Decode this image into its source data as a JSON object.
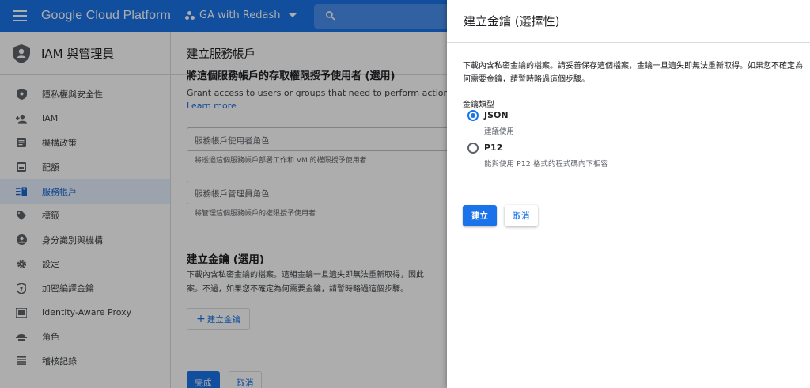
{
  "topbar": {
    "brand": "Google Cloud Platform",
    "project": "GA with Redash",
    "accent_color": "#1a73e8"
  },
  "sidebar": {
    "title": "IAM 與管理員",
    "items": [
      {
        "label": "隱私權與安全性",
        "icon": "shield-check-icon"
      },
      {
        "label": "IAM",
        "icon": "person-add-icon"
      },
      {
        "label": "機構政策",
        "icon": "list-doc-icon"
      },
      {
        "label": "配額",
        "icon": "quota-icon"
      },
      {
        "label": "服務帳戶",
        "icon": "service-account-icon",
        "active": true
      },
      {
        "label": "標籤",
        "icon": "label-icon"
      },
      {
        "label": "身分識別與機構",
        "icon": "account-circle-icon"
      },
      {
        "label": "設定",
        "icon": "gear-icon"
      },
      {
        "label": "加密編譯金鑰",
        "icon": "key-shield-icon"
      },
      {
        "label": "Identity-Aware Proxy",
        "icon": "iap-icon"
      },
      {
        "label": "角色",
        "icon": "roles-icon"
      },
      {
        "label": "稽核記錄",
        "icon": "audit-log-icon"
      }
    ]
  },
  "main": {
    "header": "建立服務帳戶",
    "cut_title": "將這個服務帳戶的存取權限授予使用者 (選用)",
    "grant_text": "Grant access to users or groups that need to perform actions as this",
    "learn_more": "Learn more",
    "user_role_placeholder": "服務帳戶使用者角色",
    "user_role_hint": "將透過這個服務帳戶部署工作和 VM 的權限授予使用者",
    "admin_role_placeholder": "服務帳戶管理員角色",
    "admin_role_hint": "將管理這個服務帳戶的權限授予使用者",
    "key_section_title": "建立金鑰 (選用)",
    "key_section_desc_1": "下載內含私密金鑰的檔案。這組金鑰一旦遺失即無法重新取得，因此",
    "key_section_desc_2": "案。不過，如果您不確定為何需要金鑰，請暫時略過這個步驟。",
    "create_key_button": "建立金鑰",
    "done_button": "完成",
    "cancel_button": "取消"
  },
  "dialog": {
    "title": "建立金鑰 (選擇性)",
    "description": "下載內含私密金鑰的檔案。請妥善保存這個檔案，金鑰一旦遺失即無法重新取得。如果您不確定為何需要金鑰，請暫時略過這個步驟。",
    "key_type_label": "金鑰類型",
    "options": [
      {
        "label": "JSON",
        "sub": "建議使用",
        "checked": true
      },
      {
        "label": "P12",
        "sub": "能與使用 P12 格式的程式碼向下相容",
        "checked": false
      }
    ],
    "create_button": "建立",
    "cancel_button": "取消"
  }
}
